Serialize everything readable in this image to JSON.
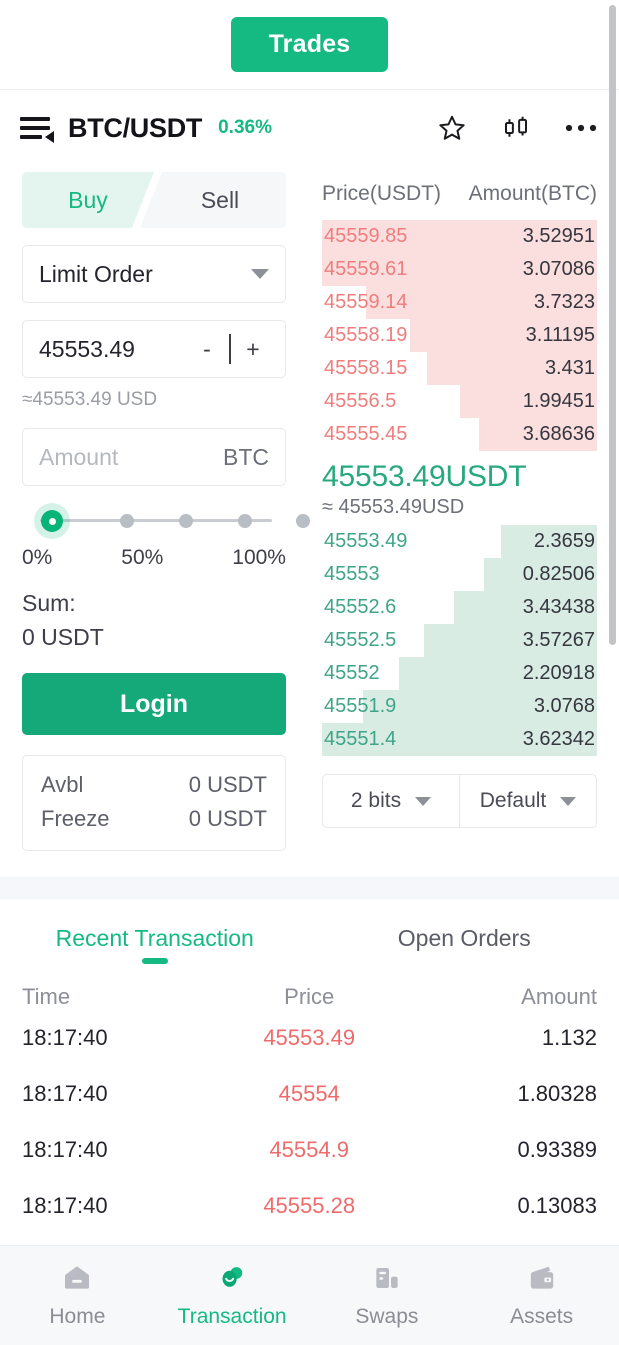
{
  "topbar": {
    "trades_label": "Trades"
  },
  "pair": {
    "symbol": "BTC/USDT",
    "change": "0.36%",
    "menu_icon": "hamburger-icon",
    "favorite_icon": "star-icon",
    "chart_icon": "candlestick-icon",
    "more_icon": "more-dots-icon"
  },
  "order_form": {
    "buy_label": "Buy",
    "sell_label": "Sell",
    "order_type": "Limit Order",
    "price_value": "45553.49",
    "minus_label": "-",
    "plus_label": "+",
    "price_approx": "≈45553.49 USD",
    "amount_placeholder": "Amount",
    "amount_unit": "BTC",
    "slider": {
      "min_label": "0%",
      "mid_label": "50%",
      "max_label": "100%",
      "value": 0,
      "steps": 5
    },
    "sum_label": "Sum:",
    "sum_value": "0 USDT",
    "login_label": "Login",
    "balance": [
      {
        "label": "Avbl",
        "value": "0 USDT"
      },
      {
        "label": "Freeze",
        "value": "0 USDT"
      }
    ]
  },
  "orderbook": {
    "col_price": "Price(USDT)",
    "col_amount": "Amount(BTC)",
    "asks": [
      {
        "price": "45559.85",
        "amount": "3.52951",
        "depth": 100
      },
      {
        "price": "45559.61",
        "amount": "3.07086",
        "depth": 100
      },
      {
        "price": "45559.14",
        "amount": "3.7323",
        "depth": 84
      },
      {
        "price": "45558.19",
        "amount": "3.11195",
        "depth": 68
      },
      {
        "price": "45558.15",
        "amount": "3.431",
        "depth": 62
      },
      {
        "price": "45556.5",
        "amount": "1.99451",
        "depth": 50
      },
      {
        "price": "45555.45",
        "amount": "3.68636",
        "depth": 43
      }
    ],
    "last_price": "45553.49USDT",
    "last_price_approx": "≈ 45553.49USD",
    "bids": [
      {
        "price": "45553.49",
        "amount": "2.3659",
        "depth": 35
      },
      {
        "price": "45553",
        "amount": "0.82506",
        "depth": 41
      },
      {
        "price": "45552.6",
        "amount": "3.43438",
        "depth": 52
      },
      {
        "price": "45552.5",
        "amount": "3.57267",
        "depth": 63
      },
      {
        "price": "45552",
        "amount": "2.20918",
        "depth": 72
      },
      {
        "price": "45551.9",
        "amount": "3.0768",
        "depth": 85
      },
      {
        "price": "45551.4",
        "amount": "3.62342",
        "depth": 100
      }
    ],
    "precision_select": "2 bits",
    "display_select": "Default"
  },
  "transactions": {
    "tab_recent": "Recent Transaction",
    "tab_open": "Open Orders",
    "columns": {
      "time": "Time",
      "price": "Price",
      "amount": "Amount"
    },
    "rows": [
      {
        "time": "18:17:40",
        "price": "45553.49",
        "amount": "1.132"
      },
      {
        "time": "18:17:40",
        "price": "45554",
        "amount": "1.80328"
      },
      {
        "time": "18:17:40",
        "price": "45554.9",
        "amount": "0.93389"
      },
      {
        "time": "18:17:40",
        "price": "45555.28",
        "amount": "0.13083"
      }
    ]
  },
  "bottom_nav": [
    {
      "label": "Home",
      "icon": "home-icon",
      "active": false
    },
    {
      "label": "Transaction",
      "icon": "transaction-icon",
      "active": true
    },
    {
      "label": "Swaps",
      "icon": "swaps-icon",
      "active": false
    },
    {
      "label": "Assets",
      "icon": "assets-icon",
      "active": false
    }
  ],
  "colors": {
    "accent": "#15b982",
    "ask": "#ef7d7d",
    "bid": "#3fa488",
    "ask_depth": "#fbdfdf",
    "bid_depth": "#d9ece4"
  }
}
